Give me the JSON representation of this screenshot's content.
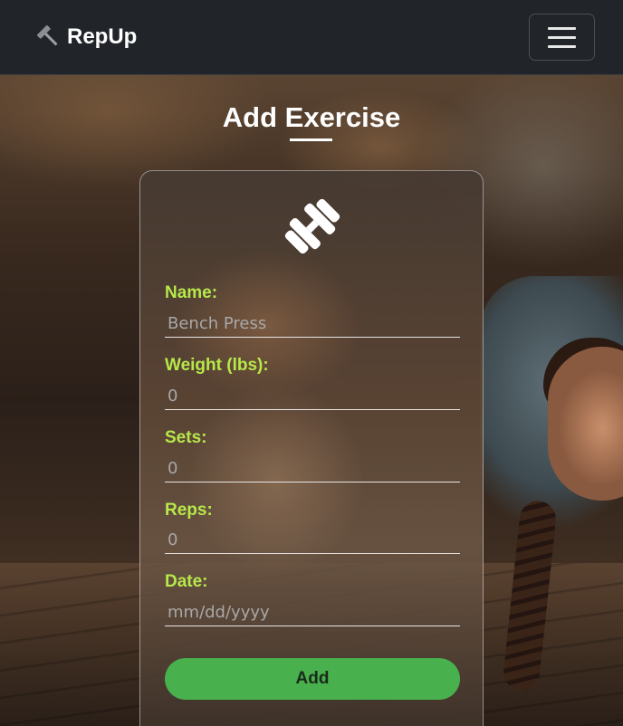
{
  "navbar": {
    "brand": "RepUp",
    "brand_icon": "hammer-icon",
    "toggle_icon": "hamburger-menu-icon"
  },
  "page": {
    "title": "Add Exercise"
  },
  "form": {
    "icon": "dumbbell-icon",
    "fields": [
      {
        "label": "Name:",
        "placeholder": "Bench Press",
        "value": ""
      },
      {
        "label": "Weight (lbs):",
        "placeholder": "0",
        "value": ""
      },
      {
        "label": "Sets:",
        "placeholder": "0",
        "value": ""
      },
      {
        "label": "Reps:",
        "placeholder": "0",
        "value": ""
      },
      {
        "label": "Date:",
        "placeholder": "mm/dd/yyyy",
        "value": ""
      }
    ],
    "submit_label": "Add"
  },
  "colors": {
    "navbar_bg": "#212529",
    "label_color": "#b6e84a",
    "button_bg": "#48b04c"
  }
}
